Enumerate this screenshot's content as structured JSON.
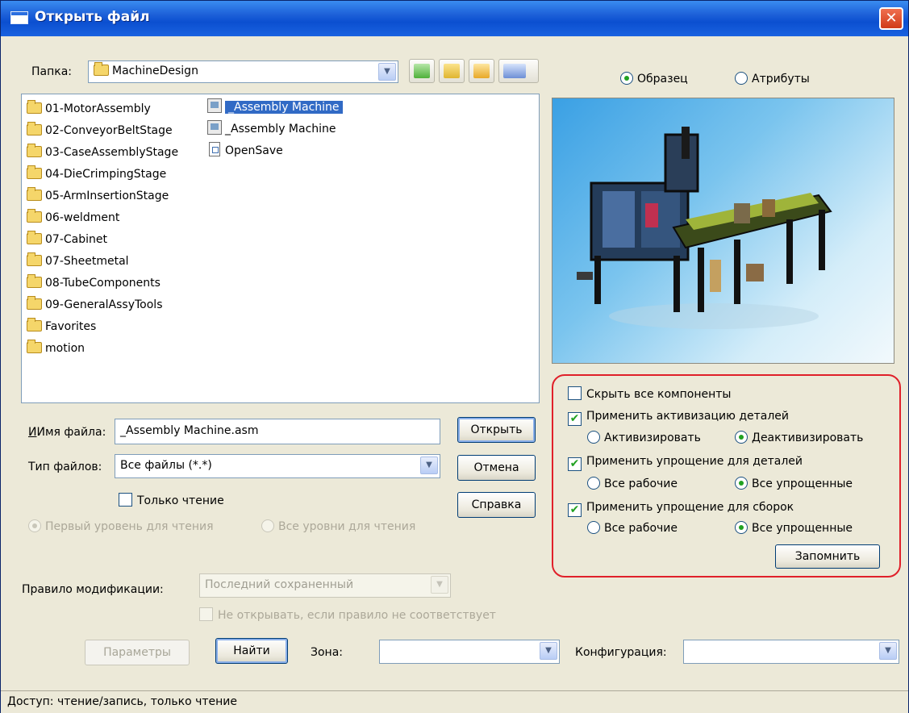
{
  "window": {
    "title": "Открыть файл",
    "close_glyph": "✕"
  },
  "folder": {
    "label": "Папка:",
    "value": "MachineDesign"
  },
  "toolbar": {
    "icons": [
      "back-icon",
      "up-folder-icon",
      "new-folder-icon",
      "view-menu-icon"
    ]
  },
  "files": [
    {
      "name": "01-MotorAssembly",
      "type": "folder"
    },
    {
      "name": "02-ConveyorBeltStage",
      "type": "folder"
    },
    {
      "name": "03-CaseAssemblyStage",
      "type": "folder"
    },
    {
      "name": "04-DieCrimpingStage",
      "type": "folder"
    },
    {
      "name": "05-ArmInsertionStage",
      "type": "folder"
    },
    {
      "name": "06-weldment",
      "type": "folder"
    },
    {
      "name": "07-Cabinet",
      "type": "folder"
    },
    {
      "name": "07-Sheetmetal",
      "type": "folder"
    },
    {
      "name": "08-TubeComponents",
      "type": "folder"
    },
    {
      "name": "09-GeneralAssyTools",
      "type": "folder"
    },
    {
      "name": "Favorites",
      "type": "folder"
    },
    {
      "name": "motion",
      "type": "folder"
    },
    {
      "name": "_Assembly Machine",
      "type": "assembly",
      "selected": true
    },
    {
      "name": "_Assembly Machine",
      "type": "assembly"
    },
    {
      "name": "OpenSave",
      "type": "document"
    }
  ],
  "filename": {
    "label": "Имя файла:",
    "value": "_Assembly Machine.asm"
  },
  "filetype": {
    "label": "Тип файлов:",
    "value": "Все файлы (*.*)"
  },
  "readonly": {
    "label": "Только чтение",
    "checked": false
  },
  "read_levels": {
    "first": "Первый уровень для чтения",
    "all": "Все уровни для чтения"
  },
  "buttons": {
    "open": "Открыть",
    "cancel": "Отмена",
    "help": "Справка",
    "remember": "Запомнить",
    "params": "Параметры",
    "find": "Найти"
  },
  "preview_tabs": {
    "sample": "Образец",
    "attributes": "Атрибуты",
    "selected": "sample"
  },
  "options": {
    "hide_all": "Скрыть все компоненты",
    "apply_activation": "Применить активизацию деталей",
    "activate": "Активизировать",
    "deactivate": "Деактивизировать",
    "apply_simpl_parts": "Применить упрощение для деталей",
    "all_working_1": "Все рабочие",
    "all_simplified_1": "Все упрощенные",
    "apply_simpl_asm": "Применить упрощение для сборок",
    "all_working_2": "Все рабочие",
    "all_simplified_2": "Все упрощенные"
  },
  "mod_rule": {
    "label": "Правило модификации:",
    "value": "Последний сохраненный",
    "no_open": "Не открывать, если правило не соответствует"
  },
  "zone": {
    "label": "Зона:",
    "value": ""
  },
  "config": {
    "label": "Конфигурация:",
    "value": ""
  },
  "status": "Доступ: чтение/запись, только чтение",
  "colors": {
    "title_bar": "#0b4fd0",
    "selection": "#316ac5",
    "highlight_border": "#e0202a",
    "check_green": "#21a121"
  }
}
